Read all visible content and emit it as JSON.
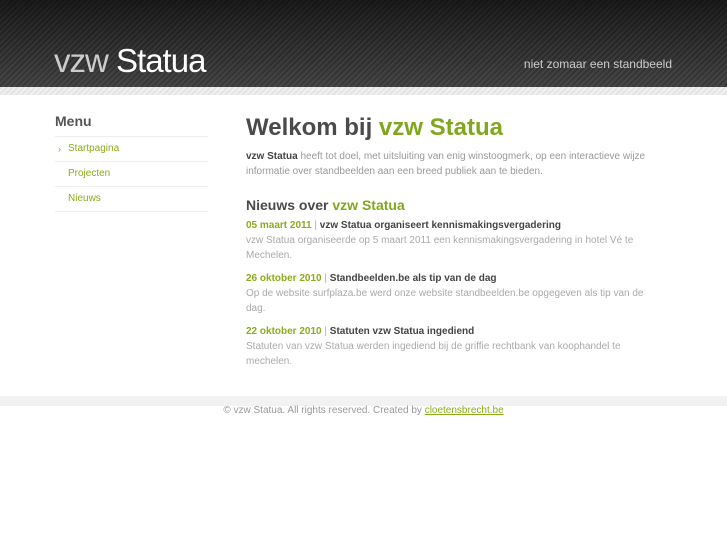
{
  "header": {
    "logo_light": "vzw",
    "logo_bold": "Statua",
    "tagline": "niet zomaar een standbeeld"
  },
  "menu": {
    "title": "Menu",
    "items": [
      {
        "label": "Startpagina",
        "active": true
      },
      {
        "label": "Projecten"
      },
      {
        "label": "Nieuws"
      }
    ]
  },
  "main": {
    "title_prefix": "Welkom bij",
    "title_accent": "vzw Statua",
    "intro_bold": "vzw Statua",
    "intro_text": " heeft tot doel, met uitsluiting van enig winstoogmerk, op een interactieve wijze informatie over standbeelden aan een breed publiek aan te bieden.",
    "news_title_prefix": "Nieuws over",
    "news_title_accent": "vzw Statua",
    "news": [
      {
        "date": "05 maart 2011",
        "title": "vzw Statua organiseert kennismakingsvergadering",
        "text": "vzw Statua organiseerde op 5 maart 2011 een kennismakingsvergadering in hotel Vé te Mechelen."
      },
      {
        "date": "26 oktober 2010",
        "title": "Standbeelden.be als tip van de dag",
        "text": "Op de website surfplaza.be werd onze website standbeelden.be opgegeven als tip van de dag."
      },
      {
        "date": "22 oktober 2010",
        "title": "Statuten vzw Statua ingediend",
        "text": "Statuten van vzw Statua werden ingediend bij de griffie rechtbank van koophandel te mechelen."
      }
    ]
  },
  "footer": {
    "text": "© vzw Statua. All rights reserved. Created by ",
    "link": "cloetensbrecht.be"
  }
}
